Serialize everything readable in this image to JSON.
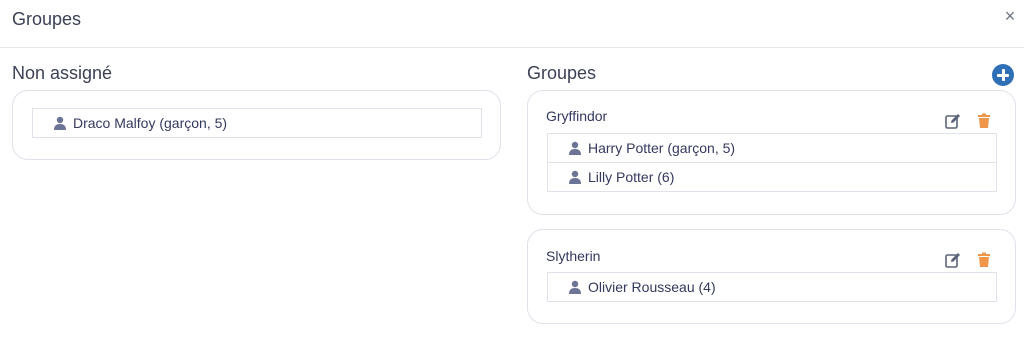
{
  "modal": {
    "title": "Groupes",
    "close_glyph": "×"
  },
  "unassigned": {
    "title": "Non assigné",
    "members": [
      {
        "label": "Draco Malfoy (garçon, 5)",
        "icon": "user-icon"
      }
    ]
  },
  "groups_section": {
    "title": "Groupes",
    "add_icon": "plus-circle-icon",
    "groups": [
      {
        "name": "Gryffindor",
        "members": [
          {
            "label": "Harry Potter (garçon, 5)",
            "icon": "user-icon"
          },
          {
            "label": "Lilly Potter (6)",
            "icon": "user-icon"
          }
        ]
      },
      {
        "name": "Slytherin",
        "members": [
          {
            "label": "Olivier Rousseau (4)",
            "icon": "user-icon"
          }
        ]
      }
    ]
  },
  "colors": {
    "accent": "#2f6fb6",
    "trash": "#f0954a",
    "edit": "#5a6378",
    "user_icon": "#6b7494"
  }
}
